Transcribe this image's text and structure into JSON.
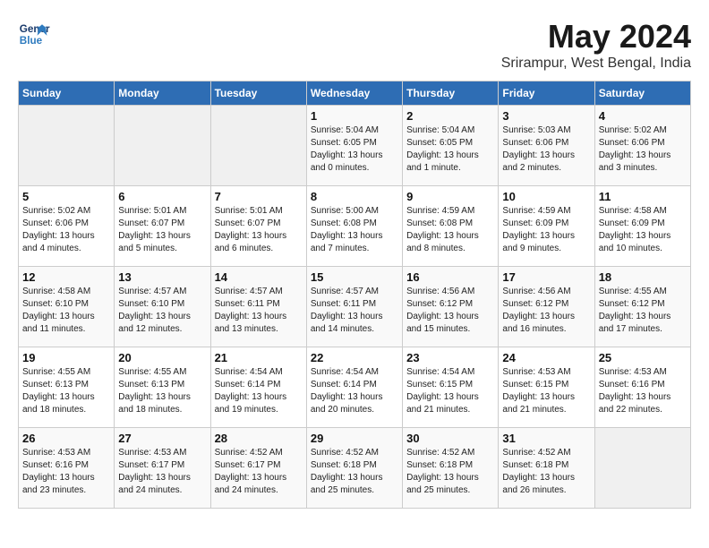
{
  "logo": {
    "line1": "General",
    "line2": "Blue"
  },
  "title": "May 2024",
  "subtitle": "Srirampur, West Bengal, India",
  "weekdays": [
    "Sunday",
    "Monday",
    "Tuesday",
    "Wednesday",
    "Thursday",
    "Friday",
    "Saturday"
  ],
  "weeks": [
    [
      {
        "day": "",
        "info": ""
      },
      {
        "day": "",
        "info": ""
      },
      {
        "day": "",
        "info": ""
      },
      {
        "day": "1",
        "info": "Sunrise: 5:04 AM\nSunset: 6:05 PM\nDaylight: 13 hours\nand 0 minutes."
      },
      {
        "day": "2",
        "info": "Sunrise: 5:04 AM\nSunset: 6:05 PM\nDaylight: 13 hours\nand 1 minute."
      },
      {
        "day": "3",
        "info": "Sunrise: 5:03 AM\nSunset: 6:06 PM\nDaylight: 13 hours\nand 2 minutes."
      },
      {
        "day": "4",
        "info": "Sunrise: 5:02 AM\nSunset: 6:06 PM\nDaylight: 13 hours\nand 3 minutes."
      }
    ],
    [
      {
        "day": "5",
        "info": "Sunrise: 5:02 AM\nSunset: 6:06 PM\nDaylight: 13 hours\nand 4 minutes."
      },
      {
        "day": "6",
        "info": "Sunrise: 5:01 AM\nSunset: 6:07 PM\nDaylight: 13 hours\nand 5 minutes."
      },
      {
        "day": "7",
        "info": "Sunrise: 5:01 AM\nSunset: 6:07 PM\nDaylight: 13 hours\nand 6 minutes."
      },
      {
        "day": "8",
        "info": "Sunrise: 5:00 AM\nSunset: 6:08 PM\nDaylight: 13 hours\nand 7 minutes."
      },
      {
        "day": "9",
        "info": "Sunrise: 4:59 AM\nSunset: 6:08 PM\nDaylight: 13 hours\nand 8 minutes."
      },
      {
        "day": "10",
        "info": "Sunrise: 4:59 AM\nSunset: 6:09 PM\nDaylight: 13 hours\nand 9 minutes."
      },
      {
        "day": "11",
        "info": "Sunrise: 4:58 AM\nSunset: 6:09 PM\nDaylight: 13 hours\nand 10 minutes."
      }
    ],
    [
      {
        "day": "12",
        "info": "Sunrise: 4:58 AM\nSunset: 6:10 PM\nDaylight: 13 hours\nand 11 minutes."
      },
      {
        "day": "13",
        "info": "Sunrise: 4:57 AM\nSunset: 6:10 PM\nDaylight: 13 hours\nand 12 minutes."
      },
      {
        "day": "14",
        "info": "Sunrise: 4:57 AM\nSunset: 6:11 PM\nDaylight: 13 hours\nand 13 minutes."
      },
      {
        "day": "15",
        "info": "Sunrise: 4:57 AM\nSunset: 6:11 PM\nDaylight: 13 hours\nand 14 minutes."
      },
      {
        "day": "16",
        "info": "Sunrise: 4:56 AM\nSunset: 6:12 PM\nDaylight: 13 hours\nand 15 minutes."
      },
      {
        "day": "17",
        "info": "Sunrise: 4:56 AM\nSunset: 6:12 PM\nDaylight: 13 hours\nand 16 minutes."
      },
      {
        "day": "18",
        "info": "Sunrise: 4:55 AM\nSunset: 6:12 PM\nDaylight: 13 hours\nand 17 minutes."
      }
    ],
    [
      {
        "day": "19",
        "info": "Sunrise: 4:55 AM\nSunset: 6:13 PM\nDaylight: 13 hours\nand 18 minutes."
      },
      {
        "day": "20",
        "info": "Sunrise: 4:55 AM\nSunset: 6:13 PM\nDaylight: 13 hours\nand 18 minutes."
      },
      {
        "day": "21",
        "info": "Sunrise: 4:54 AM\nSunset: 6:14 PM\nDaylight: 13 hours\nand 19 minutes."
      },
      {
        "day": "22",
        "info": "Sunrise: 4:54 AM\nSunset: 6:14 PM\nDaylight: 13 hours\nand 20 minutes."
      },
      {
        "day": "23",
        "info": "Sunrise: 4:54 AM\nSunset: 6:15 PM\nDaylight: 13 hours\nand 21 minutes."
      },
      {
        "day": "24",
        "info": "Sunrise: 4:53 AM\nSunset: 6:15 PM\nDaylight: 13 hours\nand 21 minutes."
      },
      {
        "day": "25",
        "info": "Sunrise: 4:53 AM\nSunset: 6:16 PM\nDaylight: 13 hours\nand 22 minutes."
      }
    ],
    [
      {
        "day": "26",
        "info": "Sunrise: 4:53 AM\nSunset: 6:16 PM\nDaylight: 13 hours\nand 23 minutes."
      },
      {
        "day": "27",
        "info": "Sunrise: 4:53 AM\nSunset: 6:17 PM\nDaylight: 13 hours\nand 24 minutes."
      },
      {
        "day": "28",
        "info": "Sunrise: 4:52 AM\nSunset: 6:17 PM\nDaylight: 13 hours\nand 24 minutes."
      },
      {
        "day": "29",
        "info": "Sunrise: 4:52 AM\nSunset: 6:18 PM\nDaylight: 13 hours\nand 25 minutes."
      },
      {
        "day": "30",
        "info": "Sunrise: 4:52 AM\nSunset: 6:18 PM\nDaylight: 13 hours\nand 25 minutes."
      },
      {
        "day": "31",
        "info": "Sunrise: 4:52 AM\nSunset: 6:18 PM\nDaylight: 13 hours\nand 26 minutes."
      },
      {
        "day": "",
        "info": ""
      }
    ]
  ]
}
